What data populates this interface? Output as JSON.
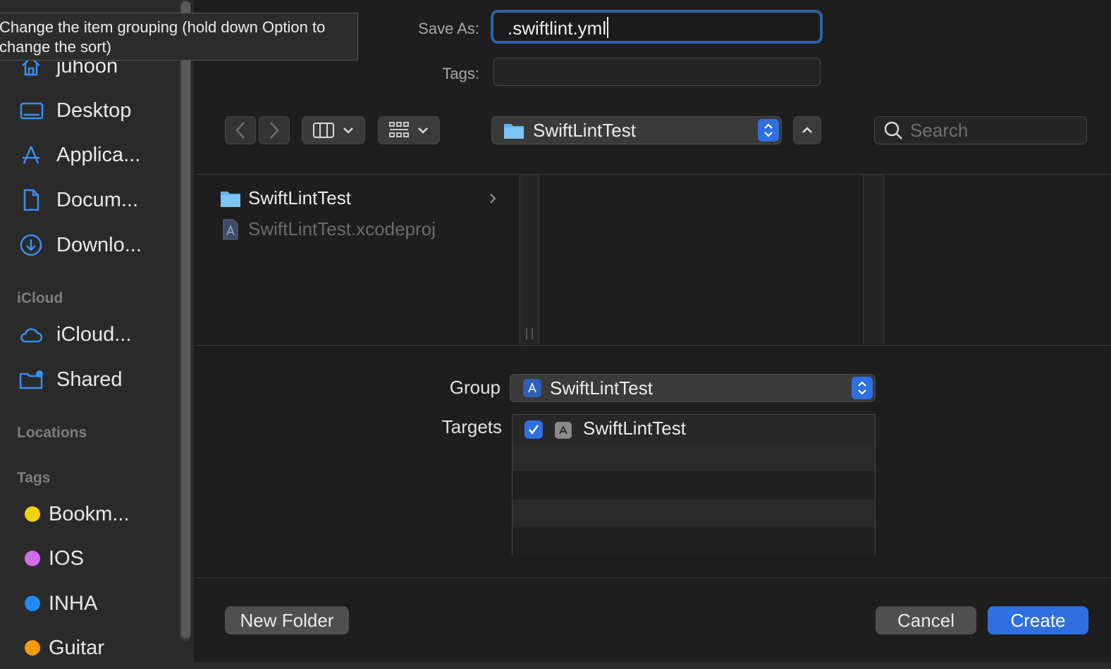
{
  "tooltip": {
    "line1": "Change the item grouping (hold down Option to",
    "line2": "change the sort)"
  },
  "sidebar": {
    "favorites": [
      {
        "label": "juhoon",
        "icon": "home-icon"
      },
      {
        "label": "Desktop",
        "icon": "desktop-icon"
      },
      {
        "label": "Applica...",
        "icon": "applications-icon"
      },
      {
        "label": "Docum...",
        "icon": "document-icon"
      },
      {
        "label": "Downlo...",
        "icon": "download-icon"
      }
    ],
    "icloud_heading": "iCloud",
    "icloud": [
      {
        "label": "iCloud...",
        "icon": "cloud-icon"
      },
      {
        "label": "Shared",
        "icon": "shared-folder-icon"
      }
    ],
    "locations_heading": "Locations",
    "tags_heading": "Tags",
    "tags": [
      {
        "label": "Bookm...",
        "color": "#f5d20e"
      },
      {
        "label": "IOS",
        "color": "#d36be8"
      },
      {
        "label": "INHA",
        "color": "#1e8cf5"
      },
      {
        "label": "Guitar",
        "color": "#f49a12"
      }
    ]
  },
  "form": {
    "save_as_label": "Save As:",
    "save_as_value": ".swiftlint.yml",
    "tags_label": "Tags:"
  },
  "toolbar": {
    "path": "SwiftLintTest",
    "search_placeholder": "Search"
  },
  "browser": {
    "items": [
      {
        "name": "SwiftLintTest",
        "kind": "folder",
        "enabled": true
      },
      {
        "name": "SwiftLintTest.xcodeproj",
        "kind": "project",
        "enabled": false
      }
    ]
  },
  "options": {
    "group_label": "Group",
    "group_value": "SwiftLintTest",
    "targets_label": "Targets",
    "targets": [
      {
        "name": "SwiftLintTest",
        "checked": true
      }
    ]
  },
  "buttons": {
    "new_folder": "New Folder",
    "cancel": "Cancel",
    "create": "Create"
  },
  "colors": {
    "accent": "#2f6fe0",
    "focus_ring": "#2b62a8"
  }
}
